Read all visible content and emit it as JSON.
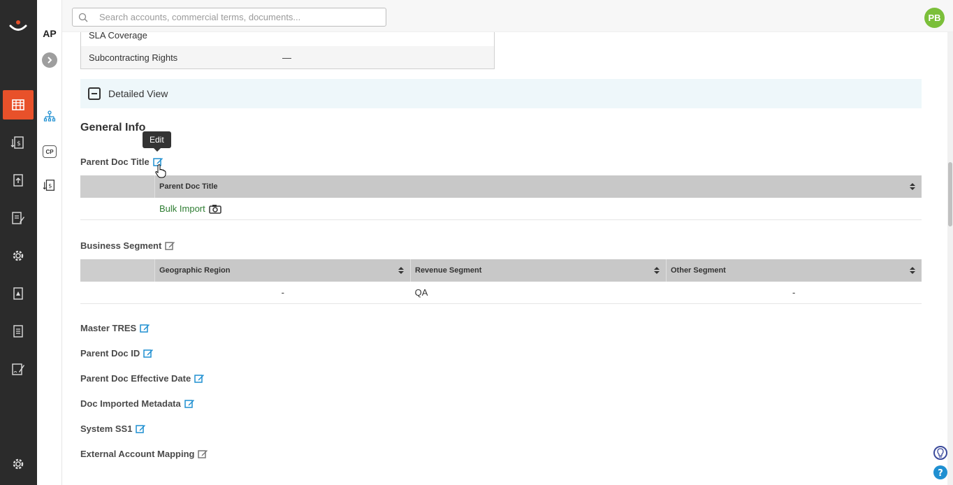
{
  "search": {
    "placeholder": "Search accounts, commercial terms, documents..."
  },
  "user": {
    "initials": "PB",
    "avatar_color": "#7bbf3a"
  },
  "subnav": {
    "title": "AP",
    "cp_label": "CP"
  },
  "colors": {
    "accent": "#e8512a",
    "link": "#1f8fd1",
    "rail": "#2b2b2b"
  },
  "previous_table": {
    "rows": [
      {
        "key": "SLA Coverage",
        "value": ""
      },
      {
        "key": "Subcontracting Rights",
        "value": "—"
      }
    ]
  },
  "detailed_view": {
    "title": "Detailed View"
  },
  "general_info": {
    "title": "General Info",
    "tooltip": "Edit",
    "parent_doc_title": {
      "label": "Parent Doc Title",
      "column": "Parent Doc Title",
      "value": "Bulk Import"
    },
    "business_segment": {
      "label": "Business Segment",
      "columns": [
        "Geographic Region",
        "Revenue Segment",
        "Other Segment"
      ],
      "values": [
        "-",
        "QA",
        "-"
      ]
    },
    "fields": [
      "Master TRES",
      "Parent Doc ID",
      "Parent Doc Effective Date",
      "Doc Imported Metadata",
      "System SS1",
      "External Account Mapping"
    ]
  }
}
